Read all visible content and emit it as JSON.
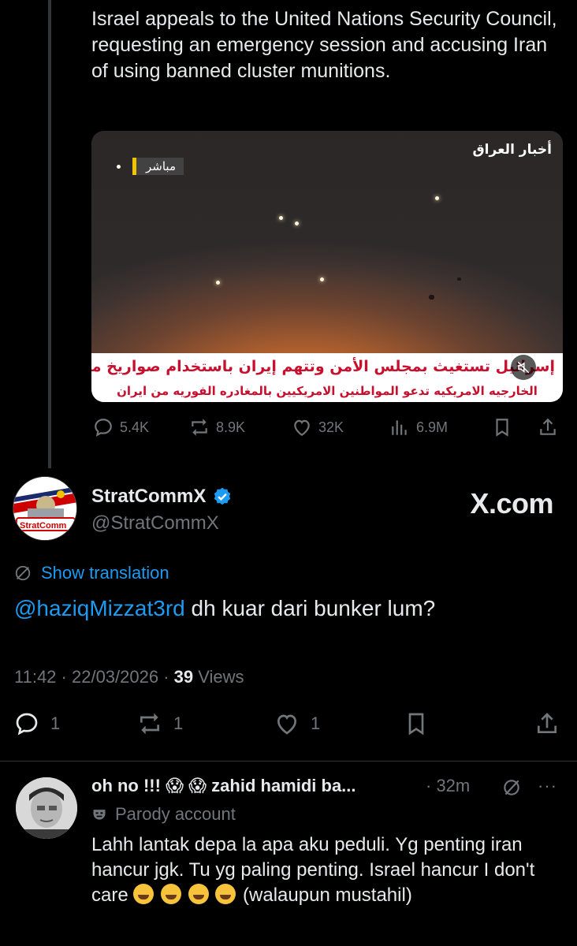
{
  "quoted_post": {
    "text": "Israel appeals to the United Nations Security Council, requesting an emergency session and accusing Iran of using banned cluster munitions.",
    "media": {
      "live_label": "مباشر",
      "channel_logo": "أخبار العراق",
      "ticker_line1": "إسرائيل تستغيث بمجلس الأمن وتتهم إيران باستخدام صواريخ محرمة دوليا",
      "ticker_line2": "الخارجيه الامريكيه تدعو المواطنين الامريكيين بالمغادره الفوريه من ايران"
    },
    "stats": {
      "replies": "5.4K",
      "reposts": "8.9K",
      "likes": "32K",
      "views": "6.9M"
    }
  },
  "post": {
    "display_name": "StratCommX",
    "handle": "@StratCommX",
    "avatar_text": "StratComm",
    "watermark": "X.com",
    "show_translation": "Show translation",
    "mention": "@haziqMizzat3rd",
    "text": " dh kuar dari bunker lum?",
    "time": "11:42",
    "date": "22/03/2026",
    "views_count": "39",
    "views_label": "Views",
    "stats": {
      "replies": "1",
      "reposts": "1",
      "likes": "1"
    }
  },
  "reply": {
    "name": "oh no !!! 😱 😱 zahid hamidi ba...",
    "time": "· 32m",
    "more": "···",
    "parody_label": "Parody account",
    "text_before": "Lahh lantak depa la apa aku peduli. Yg penting iran hancur jgk. Tu yg paling penting. Israel hancur I don't care ",
    "text_after": " (walaupun mustahil)"
  },
  "colors": {
    "background": "#000000",
    "text": "#e7e9ea",
    "muted": "#71767b",
    "accent": "#1d9bf0",
    "ticker_red": "#c8102e"
  }
}
